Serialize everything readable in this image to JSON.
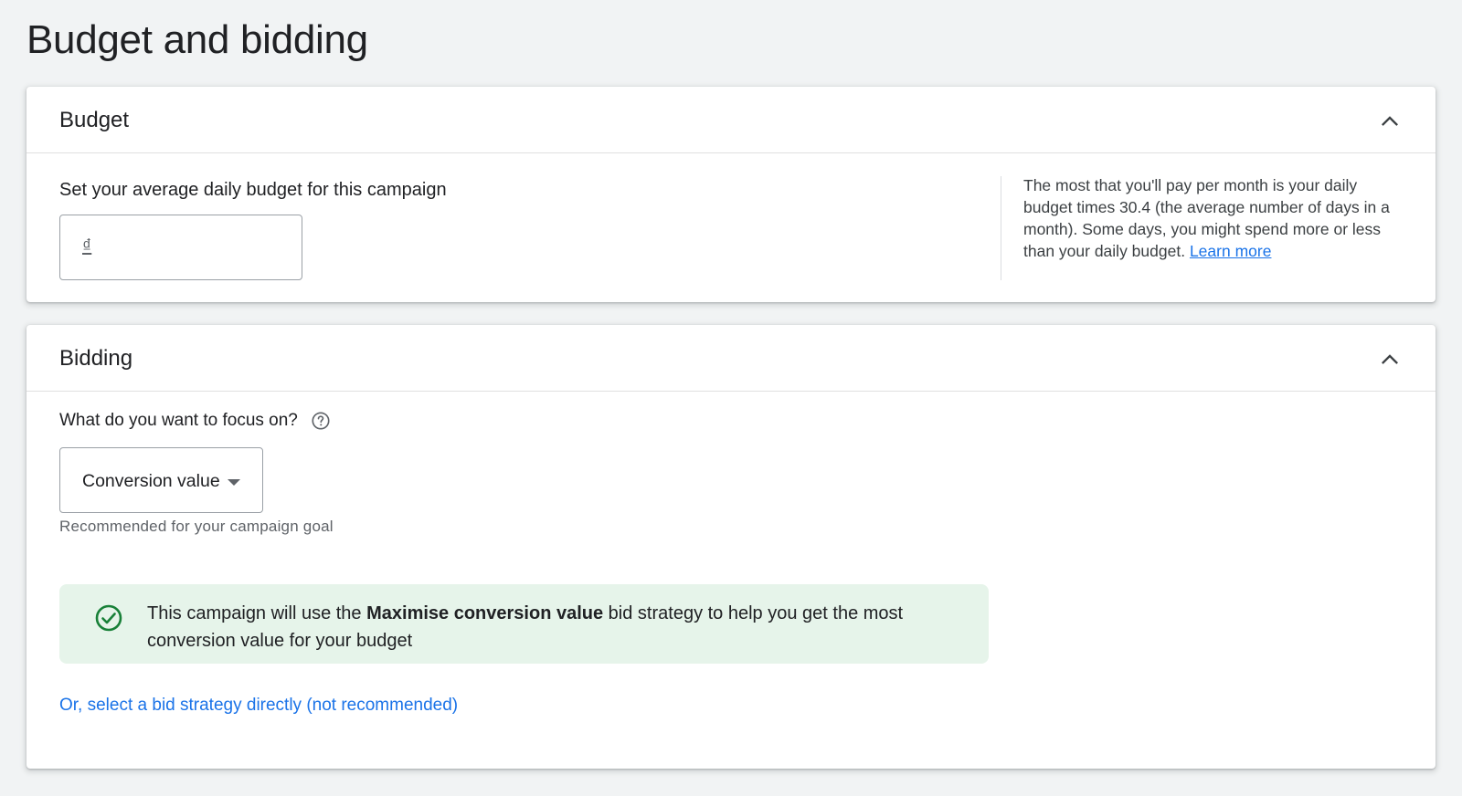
{
  "page": {
    "title": "Budget and bidding"
  },
  "budget": {
    "title": "Budget",
    "collapse_icon": "chevron-up-icon",
    "label": "Set your average daily budget for this campaign",
    "currency_symbol": "₫",
    "input_value": "",
    "help_text": "The most that you'll pay per month is your daily budget times 30.4 (the average number of days in a month). Some days, you might spend more or less than your daily budget.",
    "learn_more": "Learn more"
  },
  "bidding": {
    "title": "Bidding",
    "collapse_icon": "chevron-up-icon",
    "focus_label": "What do you want to focus on?",
    "help_icon": "help-circle-icon",
    "focus_selected": "Conversion value",
    "focus_hint": "Recommended for your campaign goal",
    "notice": {
      "icon": "check-circle-icon",
      "text_before": "This campaign will use the ",
      "text_bold": "Maximise conversion value",
      "text_after": " bid strategy to help you get the most conversion value for your budget"
    },
    "select_strategy_link": "Or, select a bid strategy directly (not recommended)"
  },
  "colors": {
    "background": "#f1f3f4",
    "card": "#ffffff",
    "link": "#1a73e8",
    "notice_bg": "#e6f4ea",
    "success_green": "#188038"
  }
}
